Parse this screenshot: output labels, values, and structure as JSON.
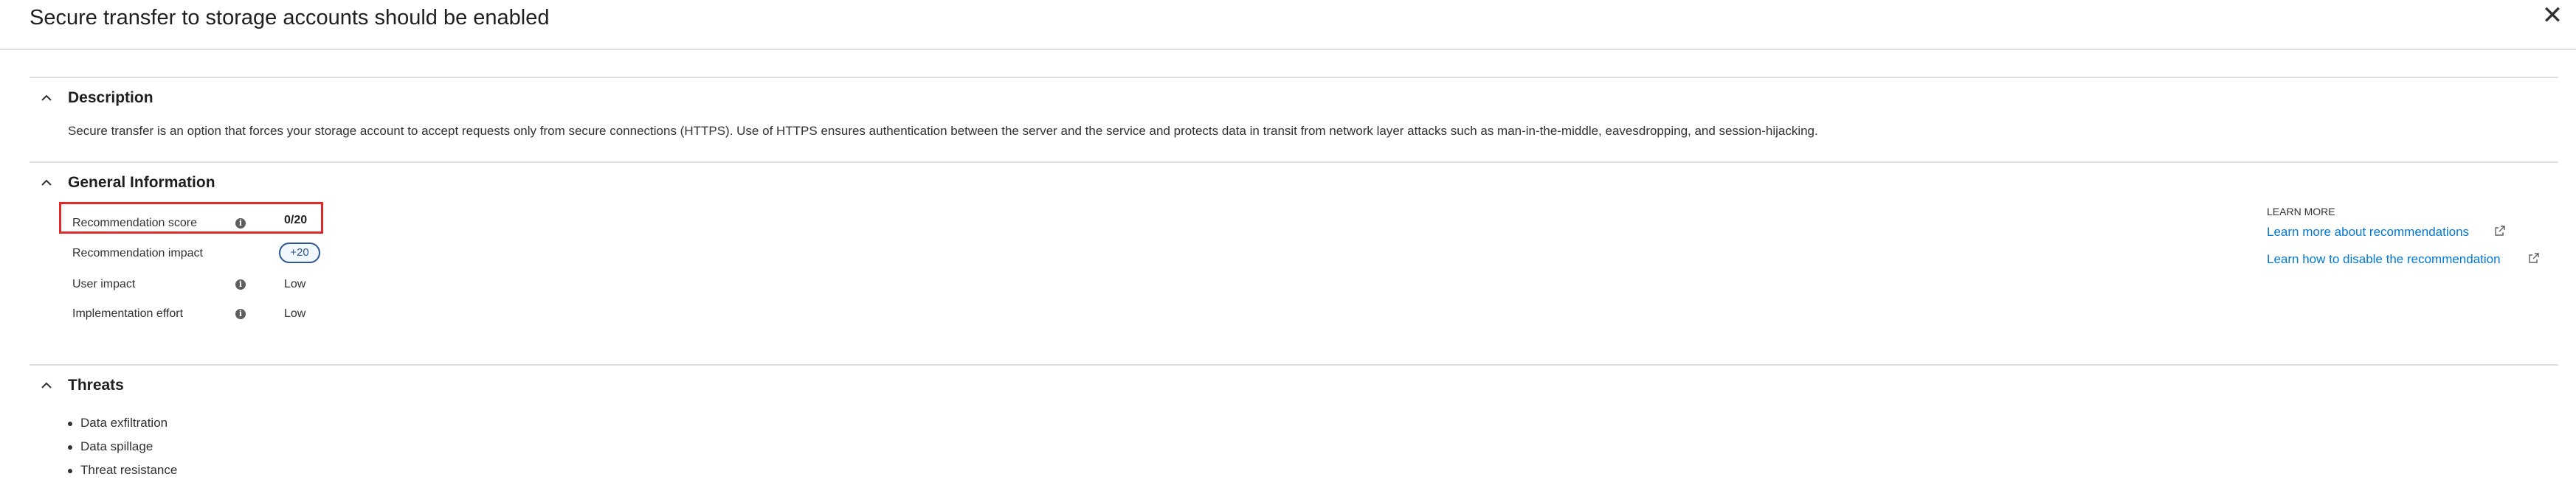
{
  "panel": {
    "title": "Secure transfer to storage accounts should be enabled",
    "close_icon": "close-icon"
  },
  "description": {
    "heading": "Description",
    "text": "Secure transfer is an option that forces your storage account to accept requests only from secure connections (HTTPS). Use of HTTPS ensures authentication between the server and the service and protects data in transit from network layer attacks such as man-in-the-middle, eavesdropping, and session-hijacking."
  },
  "general": {
    "heading": "General Information",
    "rows": [
      {
        "label": "Recommendation score",
        "value": "0/20",
        "info": true
      },
      {
        "label": "Recommendation impact",
        "value": "+20",
        "info": false
      },
      {
        "label": "User impact",
        "value": "Low",
        "info": true
      },
      {
        "label": "Implementation effort",
        "value": "Low",
        "info": true
      }
    ],
    "learn_more": {
      "heading": "LEARN MORE",
      "links": [
        "Learn more about recommendations",
        "Learn how to disable the recommendation"
      ]
    }
  },
  "threats": {
    "heading": "Threats",
    "items": [
      "Data exfiltration",
      "Data spillage",
      "Threat resistance"
    ]
  },
  "colors": {
    "highlight": "#e02a2a",
    "link": "#0078d4",
    "pill": "#2b5797"
  }
}
